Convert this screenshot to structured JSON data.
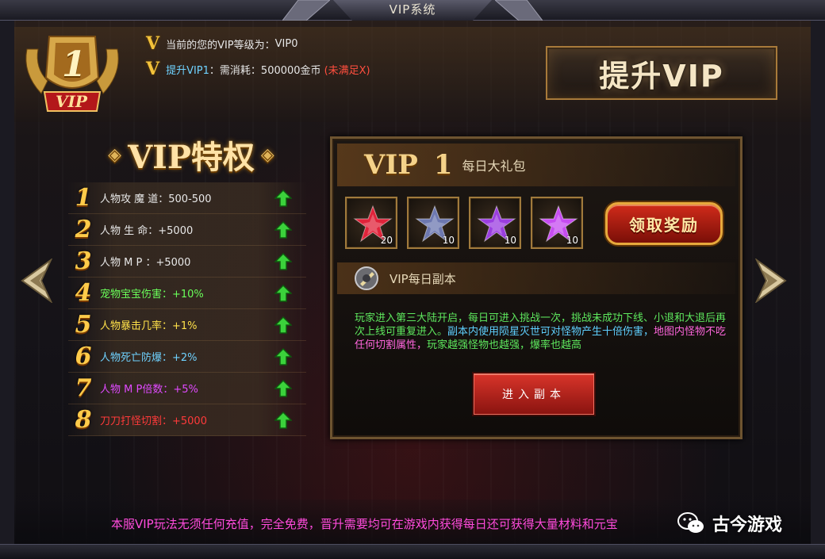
{
  "window": {
    "title": "VIP系统"
  },
  "header": {
    "badge_level": "1",
    "badge_label": "VIP",
    "current_level_label": "当前的您的VIP等级为：",
    "current_level_value": "VIP0",
    "requirement_link": "提升VIP1",
    "requirement_text": "：需消耗：500000金币",
    "requirement_status": "(未满足X)",
    "upgrade_button": "提升VIP"
  },
  "privileges": {
    "title": "VIP特权",
    "items": [
      {
        "num": "1",
        "text": "人物攻 魔 道：500-500",
        "color": "#e8e8e8"
      },
      {
        "num": "2",
        "text": "人物 生    命：+5000",
        "color": "#e8e8e8"
      },
      {
        "num": "3",
        "text": "人物 M    P ：+5000",
        "color": "#e8e8e8"
      },
      {
        "num": "4",
        "text": "宠物宝宝伤害：+10%",
        "color": "#6aff5a"
      },
      {
        "num": "5",
        "text": "人物暴击几率：+1%",
        "color": "#ffe14a"
      },
      {
        "num": "6",
        "text": "人物死亡防爆：+2%",
        "color": "#6fd2ff"
      },
      {
        "num": "7",
        "text": "人物 M P倍数：+5%",
        "color": "#e04aff"
      },
      {
        "num": "8",
        "text": "刀刀打怪切割：+5000",
        "color": "#ff3a3a"
      }
    ]
  },
  "gift_panel": {
    "vip_label": "VIP",
    "vip_level": "1",
    "subtitle": "每日大礼包",
    "items": [
      {
        "icon": "red-crystal-icon",
        "count": "20",
        "color": "#e0233a"
      },
      {
        "icon": "blue-ore-icon",
        "count": "10",
        "color": "#6d78b0"
      },
      {
        "icon": "purple-ore-icon",
        "count": "10",
        "color": "#9b3ee0"
      },
      {
        "icon": "violet-crystal-icon",
        "count": "10",
        "color": "#c64cf0"
      }
    ],
    "claim_button": "领取奖励"
  },
  "dungeon": {
    "title": "VIP每日副本",
    "desc_1": "玩家进入第三大陆开启，每日可进入挑战一次，挑战未成功下线、小退和大退后再次上线可重复进入。",
    "desc_2": "副本内使用陨星灭世可对怪物产生十倍伤害，",
    "desc_3": "地图内怪物不吃任何切割属性，",
    "desc_4": "玩家越强怪物也越强，爆率也越高",
    "enter_button": "进入副本"
  },
  "footer": {
    "note": "本服VIP玩法无须任何充值，完全免费，晋升需要均可在游戏内获得每日还可获得大量材料和元宝",
    "watermark": "古今游戏"
  }
}
